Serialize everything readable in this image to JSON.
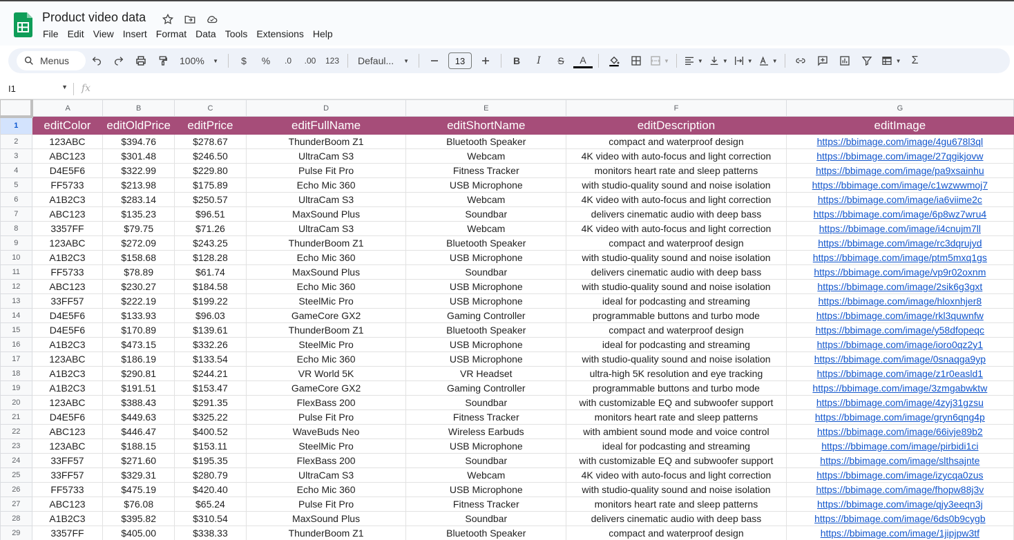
{
  "app": {
    "document_title": "Product video data",
    "menus": [
      "File",
      "Edit",
      "View",
      "Insert",
      "Format",
      "Data",
      "Tools",
      "Extensions",
      "Help"
    ]
  },
  "toolbar": {
    "search_label": "Menus",
    "zoom": "100%",
    "currency": "$",
    "percent": "%",
    "decrease_decimal": ".0",
    "increase_decimal": ".00",
    "number_format": "123",
    "font": "Defaul...",
    "font_size": "13",
    "bold": "B",
    "italic": "I",
    "strike": "S",
    "text_color": "A",
    "sum": "Σ"
  },
  "formula_bar": {
    "name_box": "I1",
    "fx": "fx"
  },
  "colors": {
    "header_fill": "#a64d79",
    "header_text": "#ffffff",
    "link": "#1155cc",
    "sheets_green": "#0f9d58"
  },
  "sheet": {
    "column_letters": [
      "A",
      "B",
      "C",
      "D",
      "E",
      "F",
      "G"
    ],
    "header_row": [
      "editColor",
      "editOldPrice",
      "editPrice",
      "editFullName",
      "editShortName",
      "editDescription",
      "editImage"
    ],
    "rows": [
      [
        "123ABC",
        "$394.76",
        "$278.67",
        "ThunderBoom Z1",
        "Bluetooth Speaker",
        "compact and waterproof design",
        "https://bbimage.com/image/4gu678l3ql"
      ],
      [
        "ABC123",
        "$301.48",
        "$246.50",
        "UltraCam S3",
        "Webcam",
        "4K video with auto-focus and light correction",
        "https://bbimage.com/image/27qgikjovw"
      ],
      [
        "D4E5F6",
        "$322.99",
        "$229.80",
        "Pulse Fit Pro",
        "Fitness Tracker",
        "monitors heart rate and sleep patterns",
        "https://bbimage.com/image/pa9xsainhu"
      ],
      [
        "FF5733",
        "$213.98",
        "$175.89",
        "Echo Mic 360",
        "USB Microphone",
        "with studio-quality sound and noise isolation",
        "https://bbimage.com/image/c1wzwwmoj7"
      ],
      [
        "A1B2C3",
        "$283.14",
        "$250.57",
        "UltraCam S3",
        "Webcam",
        "4K video with auto-focus and light correction",
        "https://bbimage.com/image/ia6viime2c"
      ],
      [
        "ABC123",
        "$135.23",
        "$96.51",
        "MaxSound Plus",
        "Soundbar",
        "delivers cinematic audio with deep bass",
        "https://bbimage.com/image/6p8wz7wru4"
      ],
      [
        "3357FF",
        "$79.75",
        "$71.26",
        "UltraCam S3",
        "Webcam",
        "4K video with auto-focus and light correction",
        "https://bbimage.com/image/i4cnujm7ll"
      ],
      [
        "123ABC",
        "$272.09",
        "$243.25",
        "ThunderBoom Z1",
        "Bluetooth Speaker",
        "compact and waterproof design",
        "https://bbimage.com/image/rc3dqrujyd"
      ],
      [
        "A1B2C3",
        "$158.68",
        "$128.28",
        "Echo Mic 360",
        "USB Microphone",
        "with studio-quality sound and noise isolation",
        "https://bbimage.com/image/ptm5mxq1gs"
      ],
      [
        "FF5733",
        "$78.89",
        "$61.74",
        "MaxSound Plus",
        "Soundbar",
        "delivers cinematic audio with deep bass",
        "https://bbimage.com/image/vp9r02oxnm"
      ],
      [
        "ABC123",
        "$230.27",
        "$184.58",
        "Echo Mic 360",
        "USB Microphone",
        "with studio-quality sound and noise isolation",
        "https://bbimage.com/image/2sik6g3gxt"
      ],
      [
        "33FF57",
        "$222.19",
        "$199.22",
        "SteelMic Pro",
        "USB Microphone",
        "ideal for podcasting and streaming",
        "https://bbimage.com/image/hloxnhjer8"
      ],
      [
        "D4E5F6",
        "$133.93",
        "$96.03",
        "GameCore GX2",
        "Gaming Controller",
        "programmable buttons and turbo mode",
        "https://bbimage.com/image/rkl3quwnfw"
      ],
      [
        "D4E5F6",
        "$170.89",
        "$139.61",
        "ThunderBoom Z1",
        "Bluetooth Speaker",
        "compact and waterproof design",
        "https://bbimage.com/image/y58dfopeqc"
      ],
      [
        "A1B2C3",
        "$473.15",
        "$332.26",
        "SteelMic Pro",
        "USB Microphone",
        "ideal for podcasting and streaming",
        "https://bbimage.com/image/ioro0qz2y1"
      ],
      [
        "123ABC",
        "$186.19",
        "$133.54",
        "Echo Mic 360",
        "USB Microphone",
        "with studio-quality sound and noise isolation",
        "https://bbimage.com/image/0snaqga9yp"
      ],
      [
        "A1B2C3",
        "$290.81",
        "$244.21",
        "VR World 5K",
        "VR Headset",
        "ultra-high 5K resolution and eye tracking",
        "https://bbimage.com/image/z1r0easld1"
      ],
      [
        "A1B2C3",
        "$191.51",
        "$153.47",
        "GameCore GX2",
        "Gaming Controller",
        "programmable buttons and turbo mode",
        "https://bbimage.com/image/3zmgabwktw"
      ],
      [
        "123ABC",
        "$388.43",
        "$291.35",
        "FlexBass 200",
        "Soundbar",
        "with customizable EQ and subwoofer support",
        "https://bbimage.com/image/4zyj31gzsu"
      ],
      [
        "D4E5F6",
        "$449.63",
        "$325.22",
        "Pulse Fit Pro",
        "Fitness Tracker",
        "monitors heart rate and sleep patterns",
        "https://bbimage.com/image/gryn6qng4p"
      ],
      [
        "ABC123",
        "$446.47",
        "$400.52",
        "WaveBuds Neo",
        "Wireless Earbuds",
        "with ambient sound mode and voice control",
        "https://bbimage.com/image/66ivje89b2"
      ],
      [
        "123ABC",
        "$188.15",
        "$153.11",
        "SteelMic Pro",
        "USB Microphone",
        "ideal for podcasting and streaming",
        "https://bbimage.com/image/pirbidi1ci"
      ],
      [
        "33FF57",
        "$271.60",
        "$195.35",
        "FlexBass 200",
        "Soundbar",
        "with customizable EQ and subwoofer support",
        "https://bbimage.com/image/slthsajnte"
      ],
      [
        "33FF57",
        "$329.31",
        "$280.79",
        "UltraCam S3",
        "Webcam",
        "4K video with auto-focus and light correction",
        "https://bbimage.com/image/izycqa0zus"
      ],
      [
        "FF5733",
        "$475.19",
        "$420.40",
        "Echo Mic 360",
        "USB Microphone",
        "with studio-quality sound and noise isolation",
        "https://bbimage.com/image/fhopw88j3v"
      ],
      [
        "ABC123",
        "$76.08",
        "$65.24",
        "Pulse Fit Pro",
        "Fitness Tracker",
        "monitors heart rate and sleep patterns",
        "https://bbimage.com/image/qjy3eeqn3j"
      ],
      [
        "A1B2C3",
        "$395.82",
        "$310.54",
        "MaxSound Plus",
        "Soundbar",
        "delivers cinematic audio with deep bass",
        "https://bbimage.com/image/6ds0b9cygb"
      ],
      [
        "3357FF",
        "$405.00",
        "$338.33",
        "ThunderBoom Z1",
        "Bluetooth Speaker",
        "compact and waterproof design",
        "https://bbimage.com/image/1jipjpw3tf"
      ]
    ]
  }
}
